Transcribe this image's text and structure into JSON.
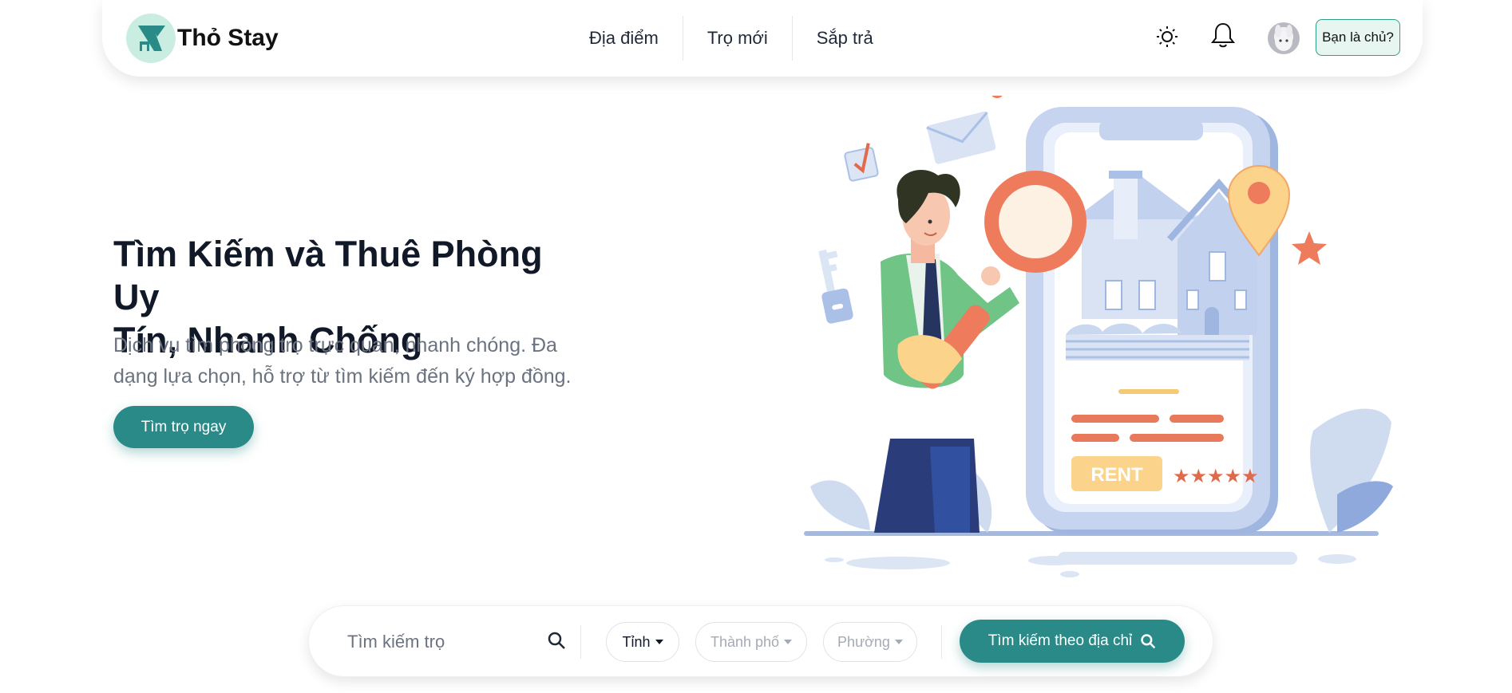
{
  "brand": {
    "name": "Thỏ Stay"
  },
  "nav": {
    "items": [
      {
        "label": "Địa điểm"
      },
      {
        "label": "Trọ mới"
      },
      {
        "label": "Sắp trả"
      }
    ]
  },
  "header_actions": {
    "theme_icon": "sun-icon",
    "notification_icon": "bell-icon",
    "owner_button": "Bạn là chủ?"
  },
  "hero": {
    "title_line1": "Tìm Kiếm và Thuê Phòng Uy",
    "title_line2": "Tín, Nhanh Chống",
    "subtitle_line1": "Dịch vụ tìm phòng trọ trực quan, nhanh chóng. Đa",
    "subtitle_line2": "dạng lựa chọn, hỗ trợ từ tìm kiếm đến ký hợp đồng.",
    "cta": "Tìm trọ ngay"
  },
  "illustration": {
    "rent_label": "RENT",
    "stars": "★★★★★"
  },
  "search": {
    "placeholder": "Tìm kiếm trọ",
    "province": "Tỉnh",
    "city": "Thành phố",
    "ward": "Phường",
    "submit": "Tìm kiếm theo địa chỉ"
  },
  "colors": {
    "primary": "#2a8a88",
    "logo_bg": "#c9eee1",
    "text_dark": "#111827",
    "text_muted": "#6b7280"
  }
}
